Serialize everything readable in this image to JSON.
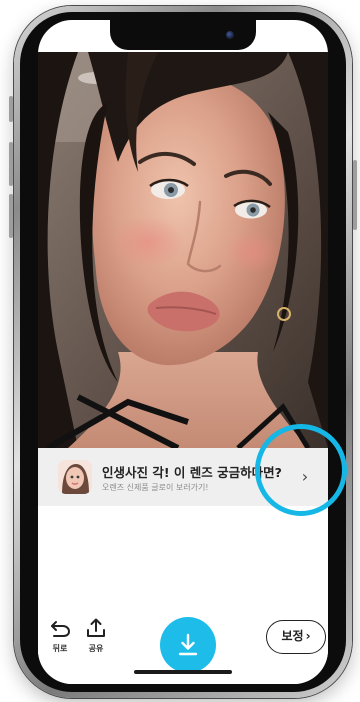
{
  "banner": {
    "title": "인생사진 각! 이 렌즈 궁금하다면?",
    "subtitle": "오렌즈 신제품 글로이 보러가기!",
    "arrow": "›"
  },
  "toolbar": {
    "back_label": "뒤로",
    "share_label": "공유",
    "edit_label": "보정",
    "edit_chevron": "›"
  },
  "icons": {
    "back": "undo-arrow-icon",
    "share": "share-upload-icon",
    "save": "download-arrow-icon",
    "banner_arrow": "chevron-right-icon"
  },
  "colors": {
    "accent": "#1ebde9",
    "highlight_ring": "#14b7e6",
    "banner_background": "#efefef",
    "text_primary": "#222222",
    "text_secondary": "#8a8a8a"
  }
}
